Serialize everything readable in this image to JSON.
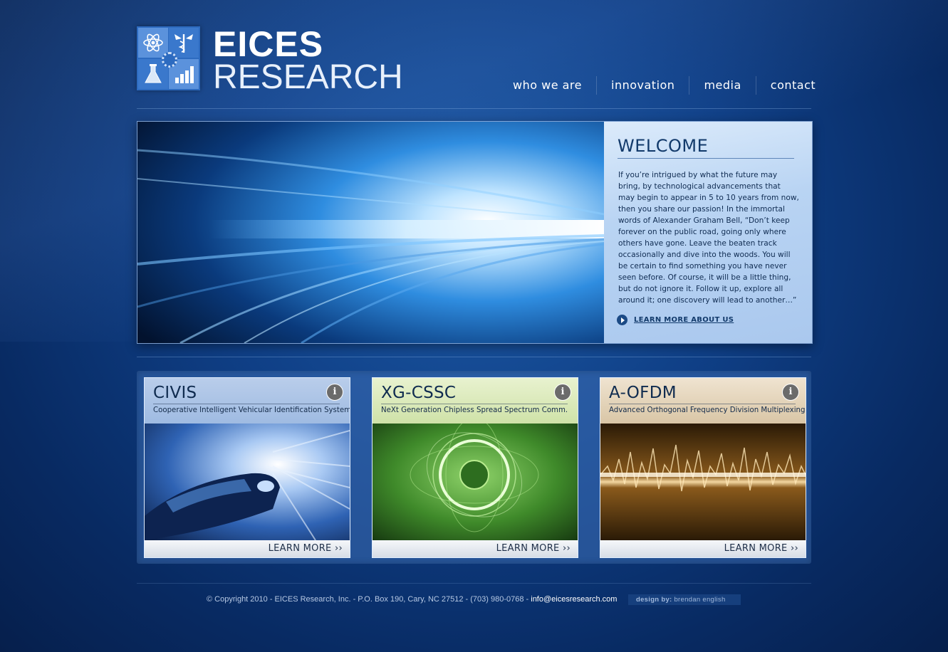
{
  "brand": {
    "title_line1": "EICES",
    "title_line2": "RESEARCH"
  },
  "nav": {
    "items": [
      "who we are",
      "innovation",
      "media",
      "contact"
    ]
  },
  "welcome": {
    "title": "WELCOME",
    "body": "If you’re intrigued by what the future may bring, by technological advancements that may begin to appear in 5 to 10 years from now, then you share our passion!  In the immortal words of Alexander Graham Bell, “Don’t keep forever on the public road, going only where others have gone.  Leave the beaten track occasionally and dive into the woods.  You will be certain to find something you have never seen before.  Of course, it will be a little thing, but do not ignore it.  Follow it up, explore all around it; one discovery will lead to another…”",
    "link_label": "LEARN MORE ABOUT US"
  },
  "cards": [
    {
      "title": "CIVIS",
      "subtitle": "Cooperative Intelligent Vehicular Identification Systems",
      "cta": "LEARN MORE ››",
      "info": "i"
    },
    {
      "title": "XG-CSSC",
      "subtitle": "NeXt Generation Chipless Spread Spectrum Comm.",
      "cta": "LEARN MORE ››",
      "info": "i"
    },
    {
      "title": "A-OFDM",
      "subtitle": "Advanced Orthogonal Frequency Division Multiplexing",
      "cta": "LEARN MORE ››",
      "info": "i"
    }
  ],
  "footer": {
    "copyright": "© Copyright 2010 - EICES Research, Inc. - P.O. Box 190, Cary, NC 27512 - (703) 980-0768 - ",
    "email": "info@eicesresearch.com",
    "design_prefix": "design by:",
    "design_name": " brendan english"
  },
  "colors": {
    "background": "#0f3f86",
    "accent": "#2d6bc0",
    "welcome_panel": "#b9d4f3"
  },
  "icons": [
    "atom-icon",
    "caduceus-icon",
    "flask-icon",
    "bar-chart-icon",
    "gear-icon",
    "play-icon",
    "info-icon"
  ]
}
